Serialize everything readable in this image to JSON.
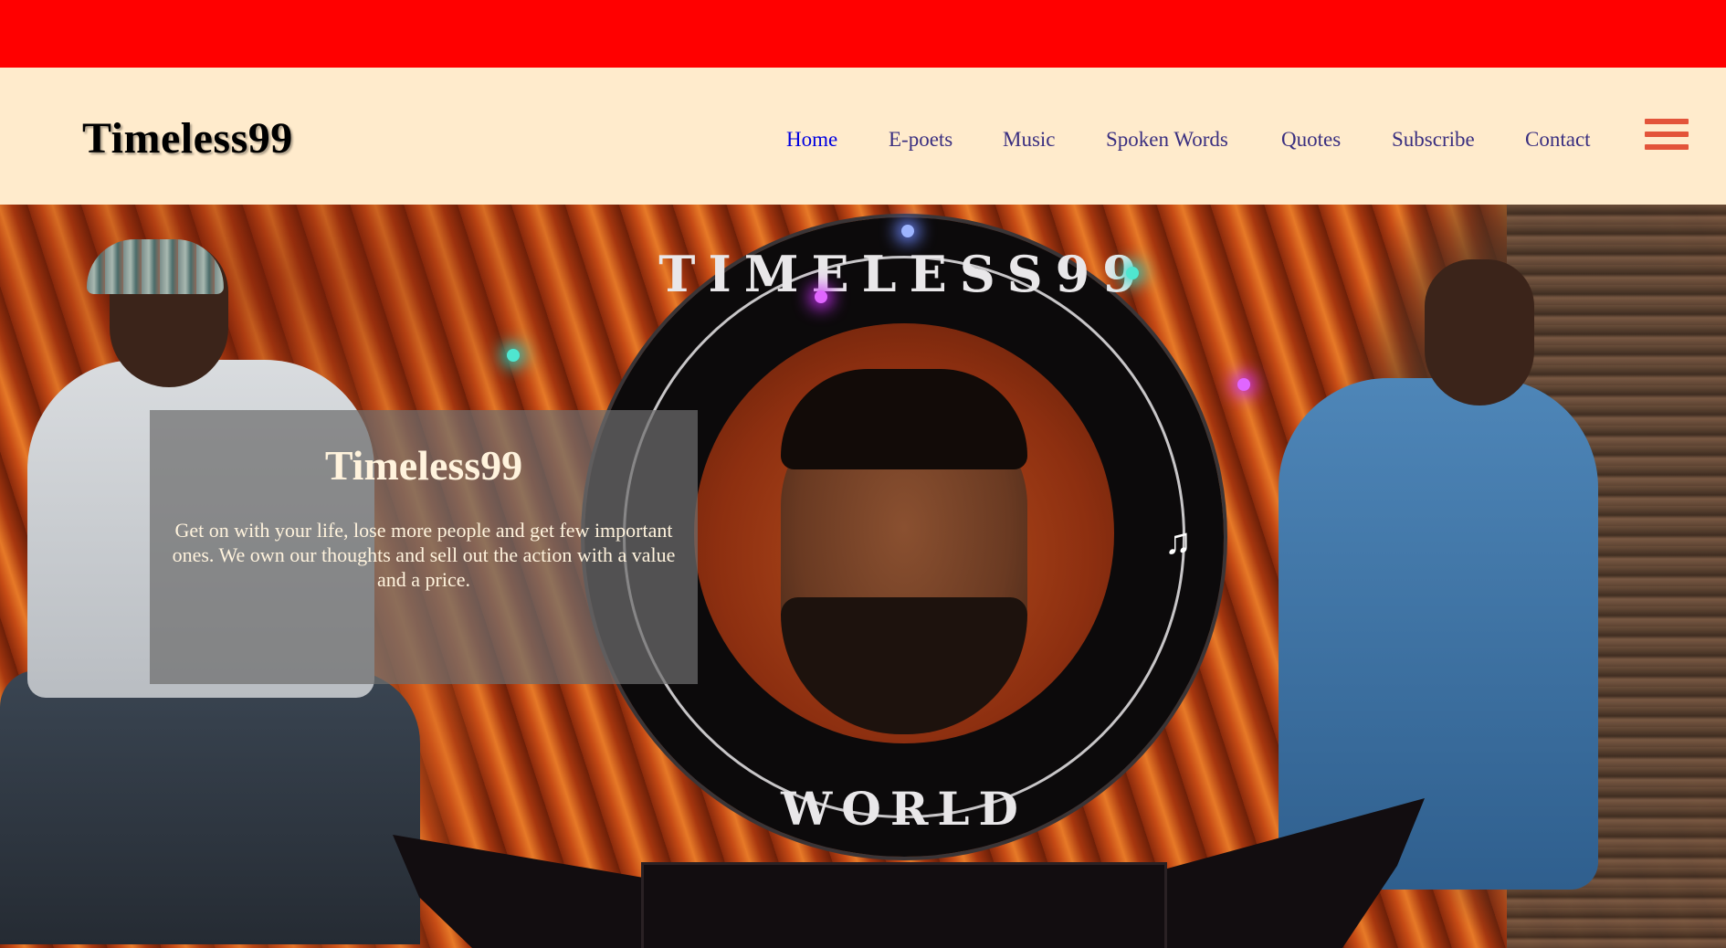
{
  "top_bar": {
    "color": "#ff0000"
  },
  "header": {
    "brand": "Timeless99",
    "nav": [
      {
        "label": "Home",
        "active": true
      },
      {
        "label": "E-poets"
      },
      {
        "label": "Music"
      },
      {
        "label": "Spoken Words"
      },
      {
        "label": "Quotes"
      },
      {
        "label": "Subscribe"
      },
      {
        "label": "Contact"
      }
    ],
    "menu_icon": "hamburger-icon",
    "colors": {
      "background": "#ffebcc",
      "nav_link": "#3a2f80",
      "nav_active": "#0000e0",
      "menu_icon": "#e3543a"
    }
  },
  "hero": {
    "card": {
      "title": "Timeless99",
      "text": "Get on with your life, lose more people and get few important ones. We own our thoughts and sell out the action with a value and a price."
    },
    "emblem": {
      "top_text": "TIMELESS99",
      "bottom_text": "WORLD",
      "icon": "music-note-icon"
    }
  }
}
